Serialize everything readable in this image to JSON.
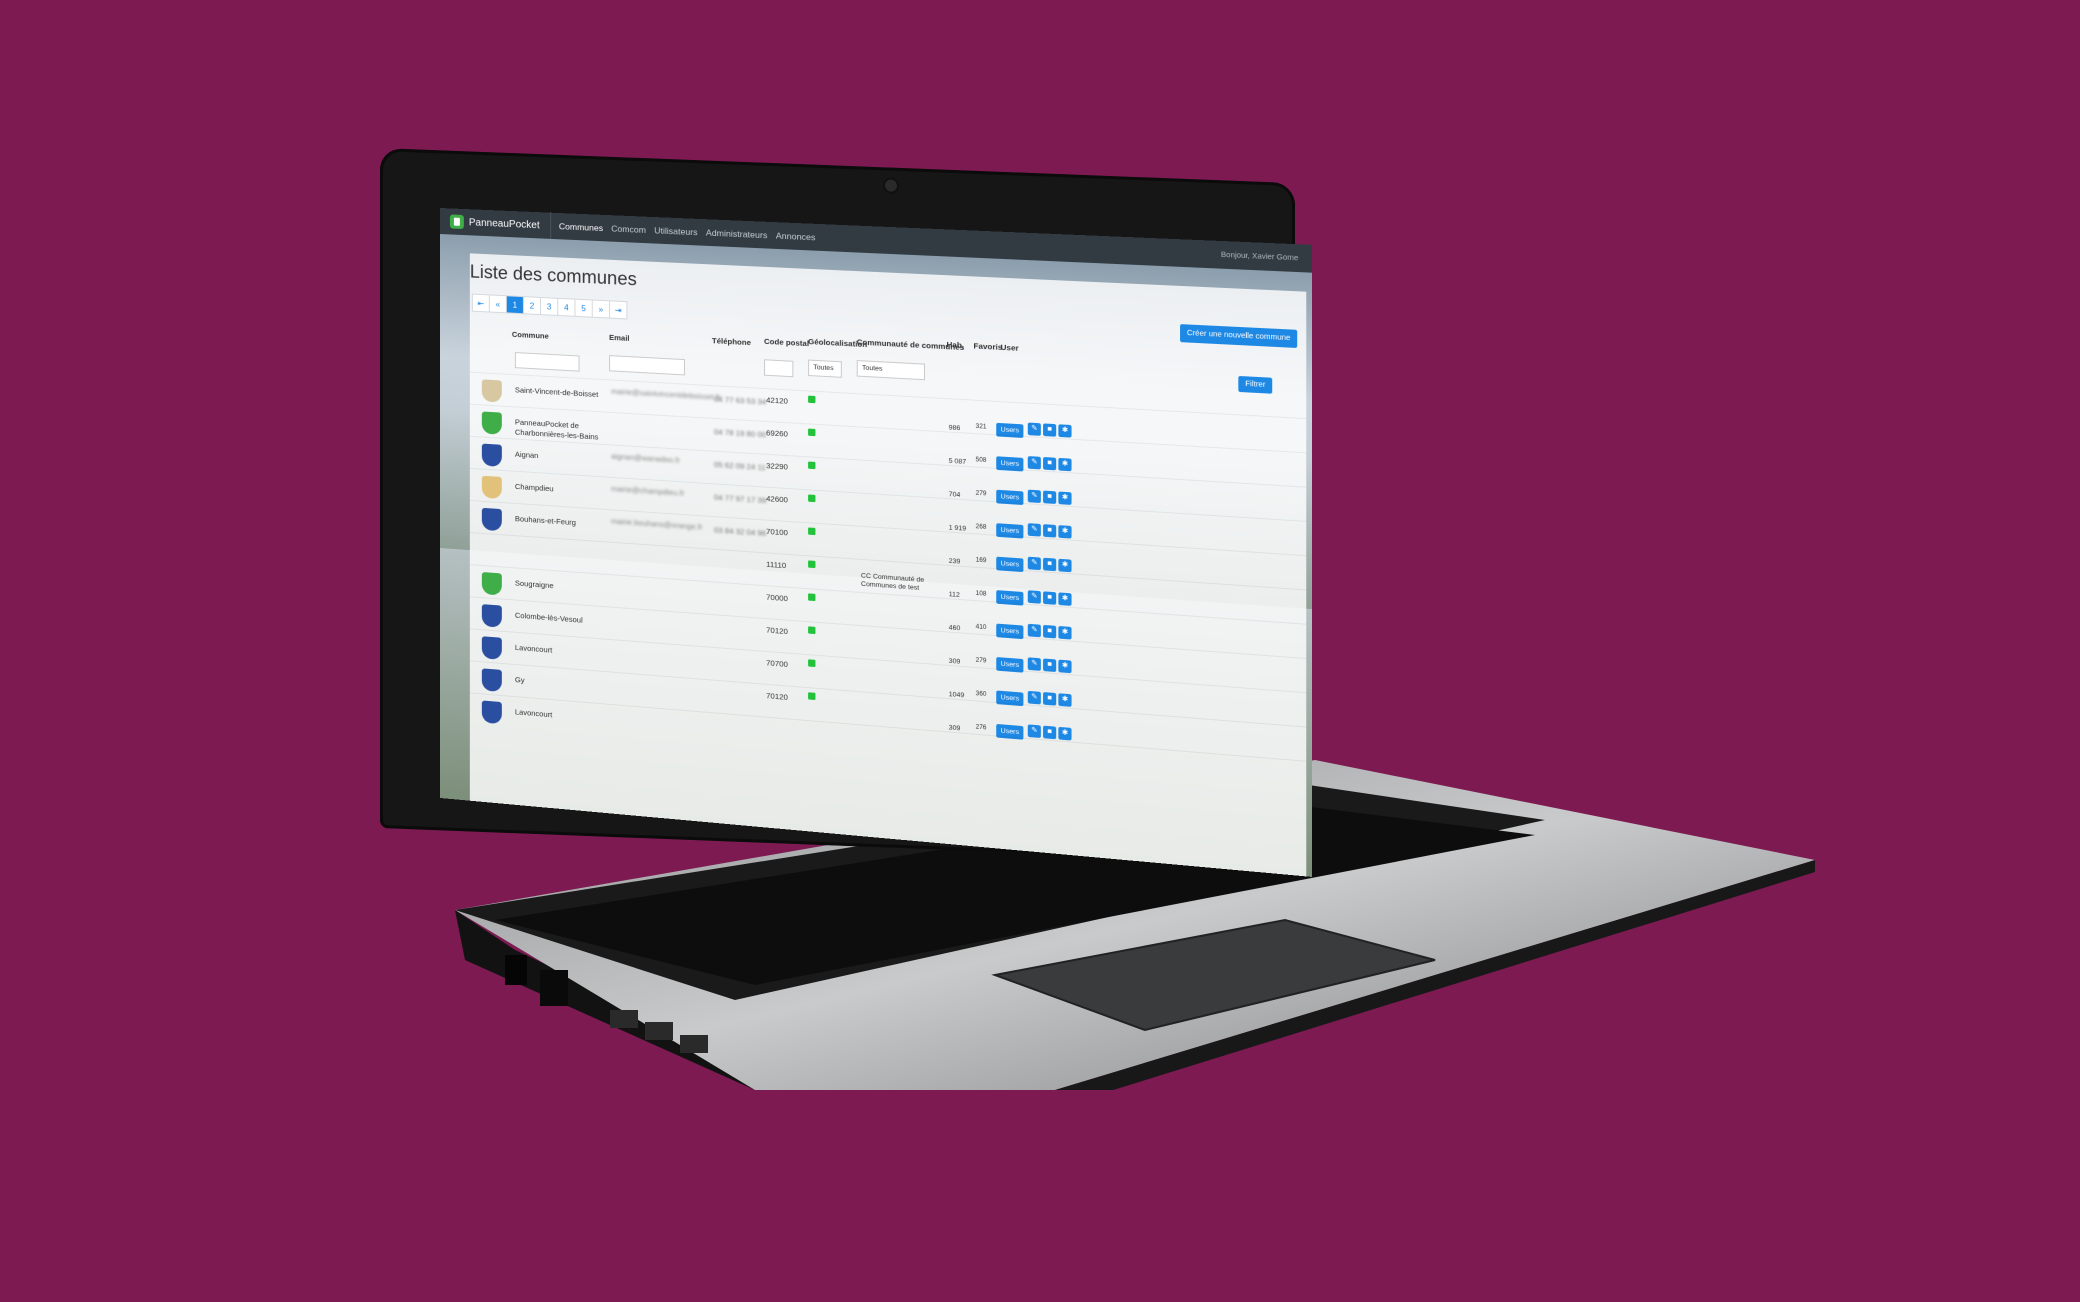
{
  "app": {
    "brand": "PanneauPocket",
    "nav": [
      "Communes",
      "Comcom",
      "Utilisateurs",
      "Administrateurs",
      "Annonces"
    ],
    "user_menu": "Bonjour, Xavier Gome"
  },
  "page": {
    "title": "Liste des communes",
    "create_button": "Créer une nouvelle commune",
    "filter_button": "Filtrer"
  },
  "pagination": [
    "⇤",
    "«",
    "1",
    "2",
    "3",
    "4",
    "5",
    "»",
    "⇥"
  ],
  "columns": [
    "Commune",
    "Email",
    "Téléphone",
    "Code postal",
    "Géolocalisation",
    "Communauté de communes",
    "Hab.",
    "Favoris",
    "User"
  ],
  "filters": {
    "geo_select": "Toutes",
    "comcom_select": "Toutes"
  },
  "rows": [
    {
      "name": "Saint-Vincent-de-Boisset",
      "email": "mairie@saintvincentdeboisset.fr",
      "phone": "04 77 63 53 34",
      "cp": "42120",
      "hab": "986",
      "fav": "321",
      "logo_color": "#d8c8a2"
    },
    {
      "name": "PanneauPocket de Charbonnières-les-Bains",
      "email": "",
      "phone": "04 78 19 80 00",
      "cp": "69260",
      "hab": "5 087",
      "fav": "508",
      "logo_color": "#3fae49"
    },
    {
      "name": "Aignan",
      "email": "aignan@wanadoo.fr",
      "phone": "05 62 09 24 11",
      "cp": "32290",
      "hab": "704",
      "fav": "279",
      "logo_color": "#2a4fa0"
    },
    {
      "name": "Champdieu",
      "email": "mairie@champdieu.fr",
      "phone": "04 77 97 17 39",
      "cp": "42600",
      "hab": "1 919",
      "fav": "268",
      "logo_color": "#e2c27a"
    },
    {
      "name": "Bouhans-et-Feurg",
      "email": "mairie.bouhans@orange.fr",
      "phone": "03 84 32 04 96",
      "cp": "70100",
      "hab": "239",
      "fav": "169",
      "logo_color": "#2a4fa0"
    },
    {
      "name": "",
      "email": "",
      "phone": "",
      "cp": "11110",
      "hab": "112",
      "fav": "108",
      "cc": "CC Communauté de Communes de test",
      "logo_color": ""
    },
    {
      "name": "Sougraigne",
      "email": "",
      "phone": "",
      "cp": "70000",
      "hab": "460",
      "fav": "410",
      "logo_color": "#3fae49"
    },
    {
      "name": "Colombe-lès-Vesoul",
      "email": "",
      "phone": "",
      "cp": "70120",
      "hab": "309",
      "fav": "279",
      "logo_color": "#2a4fa0"
    },
    {
      "name": "Lavoncourt",
      "email": "",
      "phone": "",
      "cp": "70700",
      "hab": "1049",
      "fav": "360",
      "logo_color": "#2a4fa0"
    },
    {
      "name": "Gy",
      "email": "",
      "phone": "",
      "cp": "70120",
      "hab": "309",
      "fav": "276",
      "logo_color": "#2a4fa0"
    },
    {
      "name": "Lavoncourt",
      "email": "",
      "phone": "",
      "cp": "",
      "hab": "",
      "fav": "",
      "logo_color": "#2a4fa0"
    }
  ],
  "row_buttons": {
    "users": "Users"
  },
  "colors": {
    "background": "#7d1a52",
    "primary": "#1e88e5",
    "geo_ok": "#22c23a",
    "navbar": "#323a42"
  }
}
